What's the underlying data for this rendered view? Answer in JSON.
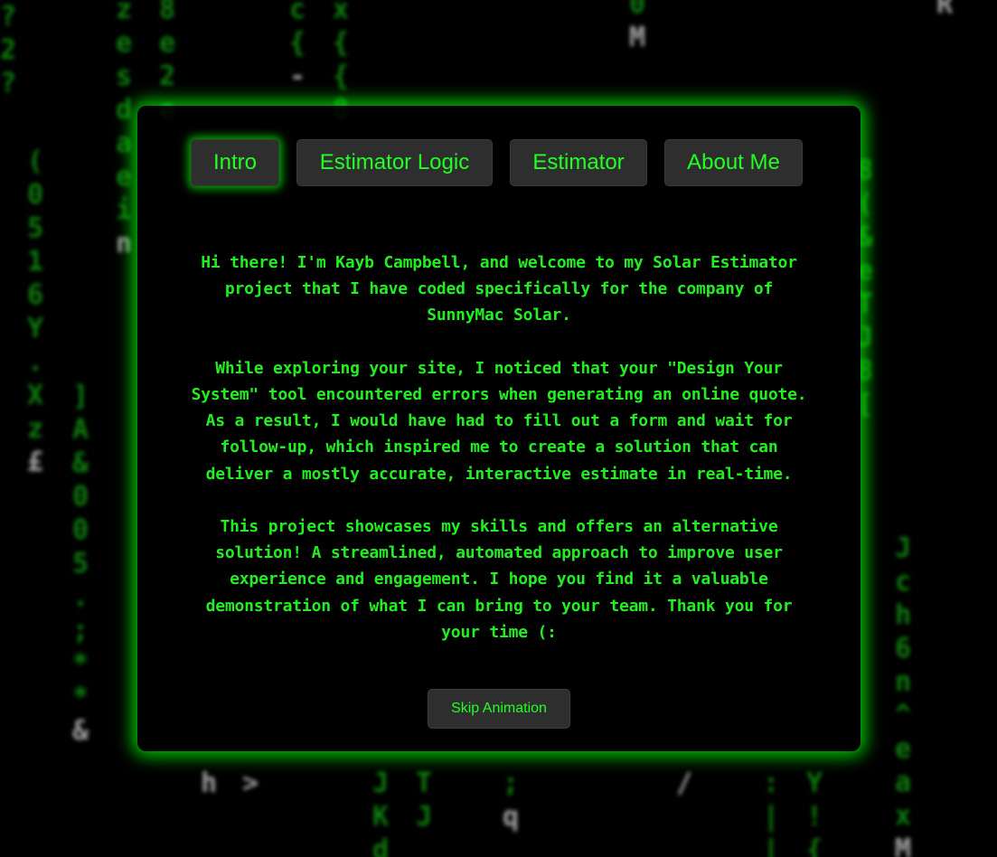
{
  "tabs": [
    {
      "label": "Intro",
      "active": true
    },
    {
      "label": "Estimator Logic",
      "active": false
    },
    {
      "label": "Estimator",
      "active": false
    },
    {
      "label": "About Me",
      "active": false
    }
  ],
  "intro": {
    "paragraphs": [
      "Hi there! I'm Kayb Campbell, and welcome to my Solar Estimator project that I have coded specifically for the company of SunnyMac Solar.",
      "While exploring your site, I noticed that your \"Design Your System\" tool encountered errors when generating an online quote. As a result, I would have had to fill out a form and wait for follow-up, which inspired me to create a solution that can deliver a mostly accurate, interactive estimate in real-time.",
      "This project showcases my skills and offers an alternative solution! A streamlined, automated approach to improve user experience and engagement. I hope you find it a valuable demonstration of what I can bring to your team. Thank you for your time (:"
    ]
  },
  "skip_button": {
    "label": "Skip Animation"
  },
  "colors": {
    "accent": "#22ff22",
    "panel_bg": "#000000",
    "button_bg": "#2e2e2e",
    "glow": "#00ff00"
  }
}
